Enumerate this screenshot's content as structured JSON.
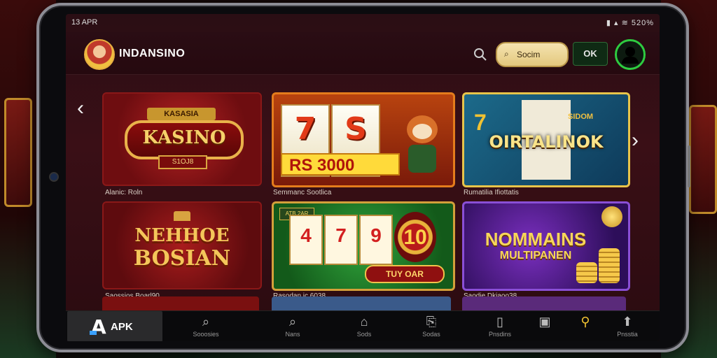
{
  "status_bar": {
    "time": "13 APR",
    "icons": "▮ ▴ ≋ 520%"
  },
  "header": {
    "brand": "INDANSINO",
    "search_placeholder": "Socim",
    "ok_label": "OK"
  },
  "games_row1": [
    {
      "ribbon": "KASASIA",
      "title": "KASINO",
      "subtitle": "S1OJ8",
      "caption": "Alanic: Roln"
    },
    {
      "reel1": "7",
      "reel2": "S",
      "bonus": "RS 3000",
      "caption": "Semmanc Sootlica"
    },
    {
      "seven": "7",
      "sub": "SIDOM",
      "title": "OIRTALINOK",
      "caption": "Rumatilia Ifiottatis"
    }
  ],
  "games_row2": [
    {
      "line1": "NEHHOE",
      "line2": "BOSIAN",
      "caption": "Saossios Boarl90"
    },
    {
      "badge": "ATB 2AR",
      "reel1": "4",
      "reel2": "7",
      "reel3": "9",
      "coin": "10",
      "button": "TUY OAR",
      "caption": "Rasodan ic 6038"
    },
    {
      "line1": "NOMMAINS",
      "line2": "MULTIPANEN",
      "caption": "Saodie Dkiaoo38"
    }
  ],
  "tabbar": {
    "logo_letter": "A",
    "logo_text": "APK",
    "tabs": [
      {
        "icon": "search-icon",
        "label": "Sooosies"
      },
      {
        "icon": "search-icon",
        "label": "Nans"
      },
      {
        "icon": "home-icon",
        "label": "Sods"
      },
      {
        "icon": "gift-icon",
        "label": "Sodas"
      },
      {
        "icon": "document-icon",
        "label": "Pnsdins"
      },
      {
        "icon": "camera-icon",
        "label": ""
      },
      {
        "icon": "lock-icon",
        "label": ""
      },
      {
        "icon": "upload-icon",
        "label": "Pnsstia"
      }
    ]
  },
  "colors": {
    "accent": "#2ecc40",
    "gold": "#e8b24a",
    "panel": "#2a0e14"
  }
}
